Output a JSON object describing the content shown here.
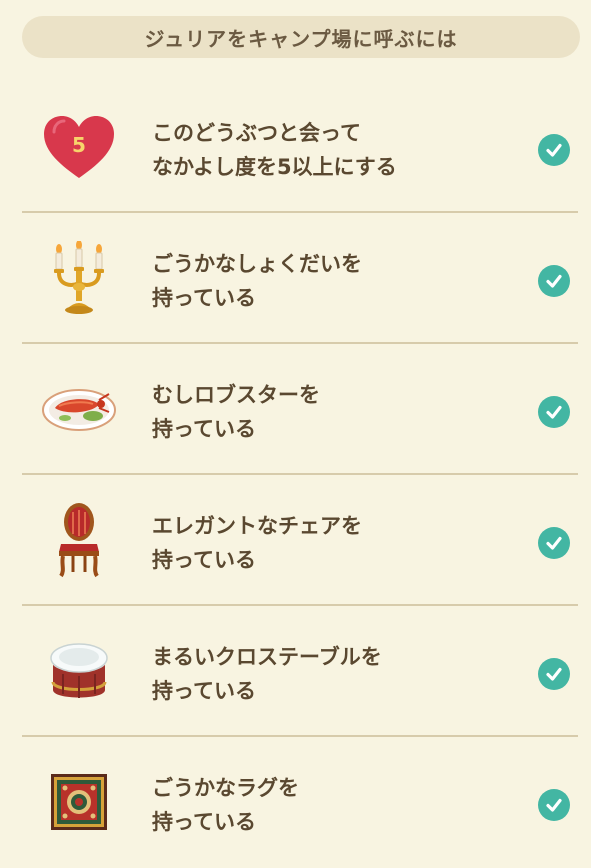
{
  "header": {
    "title": "ジュリアをキャンプ場に呼ぶには"
  },
  "items": [
    {
      "icon": "heart-icon",
      "icon_number": "5",
      "line1": "このどうぶつと会って",
      "line2": "なかよし度を5以上にする",
      "completed": true
    },
    {
      "icon": "candelabra-icon",
      "line1": "ごうかなしょくだいを",
      "line2": "持っている",
      "completed": true
    },
    {
      "icon": "lobster-dish-icon",
      "line1": "むしロブスターを",
      "line2": "持っている",
      "completed": true
    },
    {
      "icon": "elegant-chair-icon",
      "line1": "エレガントなチェアを",
      "line2": "持っている",
      "completed": true
    },
    {
      "icon": "round-table-icon",
      "line1": "まるいクロステーブルを",
      "line2": "持っている",
      "completed": true
    },
    {
      "icon": "rug-icon",
      "line1": "ごうかなラグを",
      "line2": "持っている",
      "completed": true
    }
  ],
  "colors": {
    "background": "#f8f4e1",
    "header_bg": "#ebe2c7",
    "check": "#43b6a3",
    "divider": "#d7cbab",
    "heart": "#d8384c"
  }
}
